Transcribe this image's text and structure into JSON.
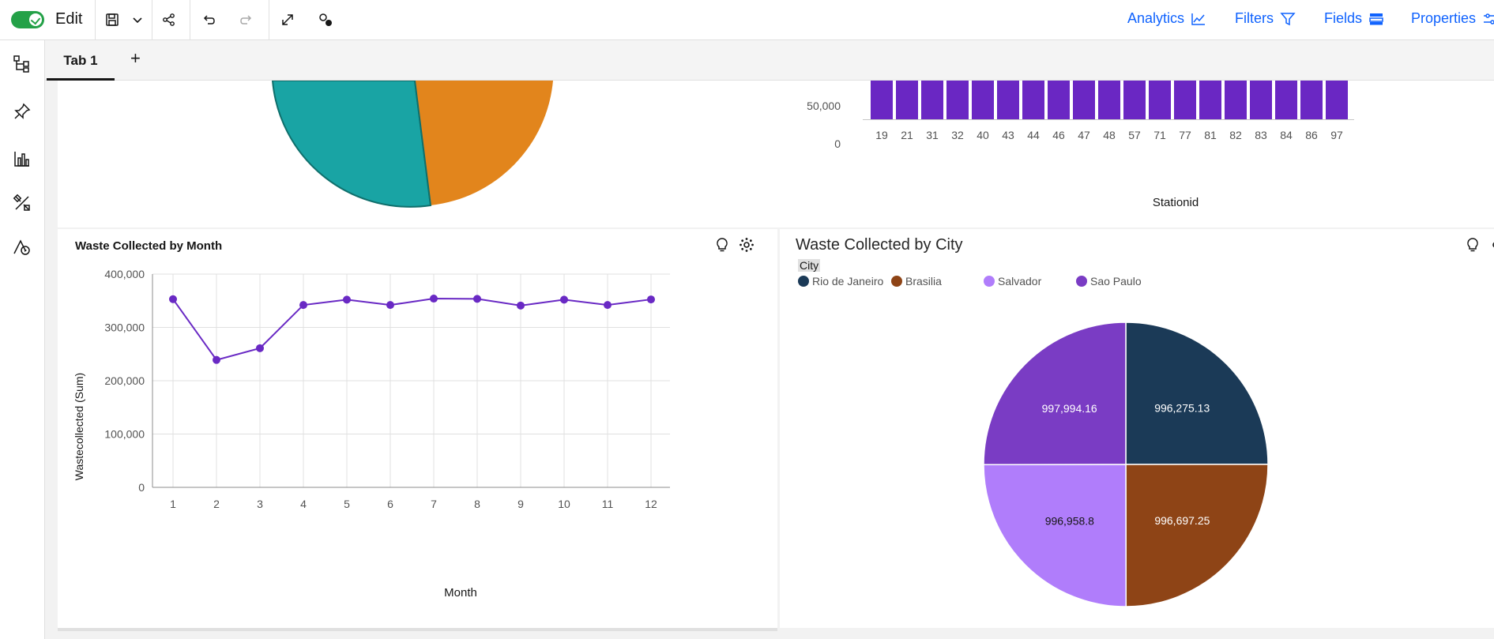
{
  "toolbar": {
    "mode_label": "Edit",
    "right_links": [
      "Analytics",
      "Filters",
      "Fields",
      "Properties"
    ]
  },
  "tabs": {
    "items": [
      "Tab 1"
    ],
    "add_label": "+"
  },
  "top_bar_chart": {
    "type": "bar",
    "xlabel": "Stationid",
    "ytick_labels": [
      "50,000",
      "0"
    ],
    "categories": [
      "19",
      "21",
      "31",
      "32",
      "40",
      "43",
      "44",
      "46",
      "47",
      "48",
      "57",
      "71",
      "77",
      "81",
      "82",
      "83",
      "84",
      "86",
      "97"
    ]
  },
  "line_chart": {
    "title": "Waste Collected by Month",
    "chart_data": {
      "type": "line",
      "xlabel": "Month",
      "ylabel": "Wastecollected (Sum)",
      "ylim": [
        0,
        400000
      ],
      "ytick_labels": [
        "400,000",
        "300,000",
        "200,000",
        "100,000",
        "0"
      ],
      "x": [
        1,
        2,
        3,
        4,
        5,
        6,
        7,
        8,
        9,
        10,
        11,
        12
      ],
      "values": [
        353000,
        239000,
        261000,
        342000,
        352000,
        342000,
        354000,
        353500,
        341000,
        352000,
        342000,
        352500
      ],
      "color": "#6929c4",
      "grid": true
    }
  },
  "pie_chart": {
    "title": "Waste Collected by City",
    "legend_title": "City",
    "chart_data": {
      "type": "pie",
      "slices": [
        {
          "label": "Rio de Janeiro",
          "value": 996275.13,
          "value_label": "996,275.13",
          "color": "#1b3a57"
        },
        {
          "label": "Brasilia",
          "value": 996697.25,
          "value_label": "996,697.25",
          "color": "#8e4416"
        },
        {
          "label": "Salvador",
          "value": 996958.8,
          "value_label": "996,958.8",
          "color": "#b07dfb"
        },
        {
          "label": "Sao Paulo",
          "value": 997994.16,
          "value_label": "997,994.16",
          "color": "#7a3cc4"
        }
      ]
    }
  },
  "colors": {
    "accent": "#0f62fe",
    "teal": "#19a4a4",
    "orange": "#e2851c",
    "bar_purple": "#6a27c3"
  }
}
